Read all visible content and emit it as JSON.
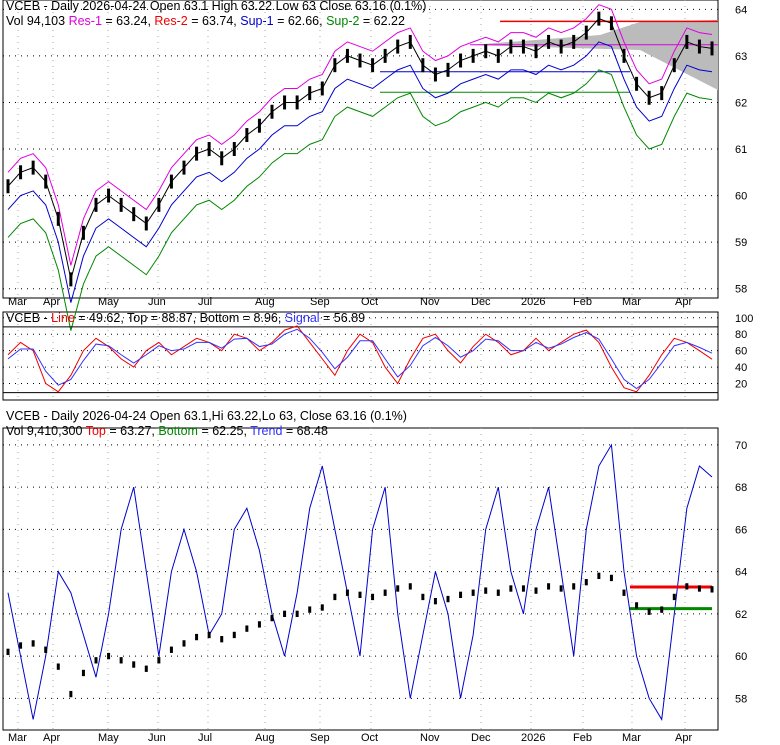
{
  "panel1": {
    "line1": "VCEB - Daily 2026-04-24 Open 63.1  High 63.22  Low 63  Close 63.16 (0.1%)",
    "vol": "Vol 94,103",
    "res1": "Res-1",
    "res1v": " = 63.24, ",
    "res2": "Res-2",
    "res2v": " = 63.74, ",
    "sup1": "Sup-1",
    "sup1v": " = 62.66, ",
    "sup2": "Sup-2",
    "sup2v": " = 62.22"
  },
  "panel2": {
    "prefix": "VCEB - ",
    "line": "Line",
    "linev": " = 49.62, Top = 88.87, Bottom = 8.96, ",
    "signal": "Signal",
    "signalv": " = 56.89"
  },
  "panel3": {
    "line1": "VCEB - Daily 2026-04-24 Open 63.1,Hi 63.22,Lo 63, Close 63.16 (0.1%)",
    "vol": "Vol 9,410,300 ",
    "top": "Top",
    "topv": " = 63.27, ",
    "bottom": "Bottom",
    "bottomv": " = 62.25, ",
    "trend": "Trend",
    "trendv": " = 68.48"
  },
  "chart_data": [
    {
      "type": "line",
      "title": "VCEB - Daily price",
      "ylim": [
        57.8,
        64.2
      ],
      "yticks": [
        64,
        63,
        62,
        61,
        60,
        59,
        58
      ],
      "months": [
        "Mar",
        "Apr",
        "May",
        "Jun",
        "Jul",
        "Aug",
        "Sep",
        "Oct",
        "Nov",
        "Dec",
        "2026",
        "Feb",
        "Mar",
        "Apr"
      ],
      "close": [
        60.2,
        60.5,
        60.6,
        60.3,
        59.5,
        58.2,
        59.2,
        59.8,
        60.0,
        59.8,
        59.6,
        59.4,
        59.8,
        60.3,
        60.6,
        60.9,
        61.0,
        60.8,
        61.0,
        61.3,
        61.5,
        61.8,
        62.0,
        62.0,
        62.2,
        62.3,
        62.8,
        63.0,
        62.9,
        62.8,
        63.0,
        63.2,
        63.3,
        62.8,
        62.6,
        62.7,
        62.9,
        63.0,
        63.1,
        63.0,
        63.2,
        63.2,
        63.1,
        63.3,
        63.2,
        63.3,
        63.5,
        63.8,
        63.7,
        63.0,
        62.4,
        62.1,
        62.2,
        62.8,
        63.3,
        63.2,
        63.16
      ],
      "res1": 63.24,
      "res2": 63.74,
      "sup1": 62.66,
      "sup2": 62.22
    },
    {
      "type": "line",
      "title": "Stochastic",
      "ylim": [
        0,
        100
      ],
      "yticks": [
        100,
        80,
        60,
        40,
        20
      ],
      "series": [
        {
          "name": "Line",
          "color": "#e00",
          "values": [
            55,
            70,
            60,
            20,
            10,
            30,
            60,
            75,
            65,
            50,
            40,
            60,
            70,
            55,
            65,
            75,
            70,
            60,
            80,
            75,
            60,
            70,
            85,
            90,
            70,
            50,
            30,
            60,
            80,
            70,
            40,
            20,
            50,
            75,
            80,
            60,
            45,
            65,
            80,
            70,
            55,
            60,
            75,
            60,
            70,
            80,
            85,
            70,
            40,
            15,
            10,
            30,
            55,
            75,
            70,
            60,
            49.62
          ]
        },
        {
          "name": "Signal",
          "color": "#33f",
          "values": [
            50,
            62,
            62,
            35,
            18,
            25,
            48,
            68,
            66,
            55,
            45,
            55,
            66,
            60,
            62,
            70,
            70,
            63,
            74,
            75,
            65,
            68,
            80,
            86,
            75,
            58,
            38,
            52,
            72,
            72,
            50,
            28,
            42,
            66,
            76,
            66,
            52,
            60,
            74,
            72,
            60,
            60,
            70,
            63,
            68,
            76,
            82,
            74,
            50,
            25,
            14,
            25,
            45,
            66,
            70,
            64,
            56.89
          ]
        }
      ],
      "top": 88.87,
      "bottom": 8.96
    },
    {
      "type": "line",
      "title": "Trend",
      "ylim": [
        56.5,
        70.5
      ],
      "yticks": [
        70,
        68,
        66,
        64,
        62,
        60,
        58
      ],
      "trend": [
        63,
        60,
        57,
        60,
        64,
        63,
        61,
        59,
        62,
        66,
        68,
        64,
        60,
        64,
        66,
        64,
        61,
        62,
        66,
        67,
        65,
        62,
        60,
        63,
        67,
        69,
        66,
        63,
        60,
        66,
        68,
        62,
        58,
        61,
        64,
        62,
        58,
        61,
        66,
        68,
        64,
        62,
        66,
        68,
        64,
        60,
        66,
        69,
        70,
        64,
        60,
        58,
        57,
        62,
        67,
        69,
        68.48
      ],
      "top": 63.27,
      "bottom": 62.25,
      "trend_value": 68.48
    }
  ]
}
